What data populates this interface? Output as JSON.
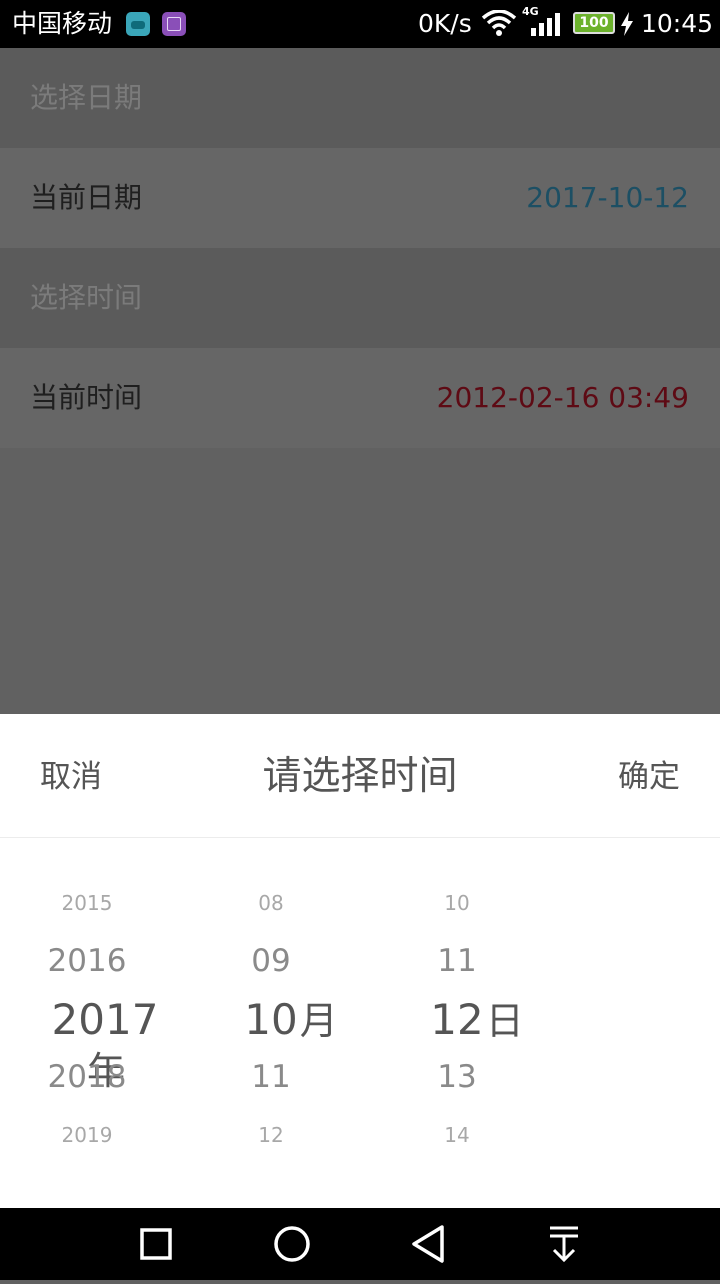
{
  "status_bar": {
    "carrier": "中国移动",
    "net_speed": "0K/s",
    "network_type": "4G",
    "battery": "100",
    "time": "10:45",
    "icons": [
      "android-app-icon",
      "gallery-app-icon",
      "wifi-icon",
      "signal-icon",
      "battery-icon",
      "charging-icon"
    ]
  },
  "main": {
    "date_section_label": "选择日期",
    "current_date_label": "当前日期",
    "current_date_value": "2017-10-12",
    "time_section_label": "选择时间",
    "current_time_label": "当前时间",
    "current_time_value": "2012-02-16 03:49"
  },
  "picker": {
    "cancel_label": "取消",
    "title": "请选择时间",
    "confirm_label": "确定",
    "year": {
      "far_prev": "2015",
      "prev": "2016",
      "selected": "2017",
      "unit": "年",
      "next": "2018",
      "far_next": "2019"
    },
    "month": {
      "far_prev": "08",
      "prev": "09",
      "selected": "10",
      "unit": "月",
      "next": "11",
      "far_next": "12"
    },
    "day": {
      "far_prev": "10",
      "prev": "11",
      "selected": "12",
      "unit": "日",
      "next": "13",
      "far_next": "14"
    }
  },
  "nav_bar": {
    "buttons": [
      "recents-icon",
      "home-icon",
      "back-icon",
      "notification-pulldown-icon"
    ]
  },
  "colors": {
    "overlay": "#616161",
    "date_value": "#1c4f64",
    "time_value": "#5e0a14",
    "sheet_bg": "#ffffff",
    "statusbar_bg": "#000000"
  }
}
